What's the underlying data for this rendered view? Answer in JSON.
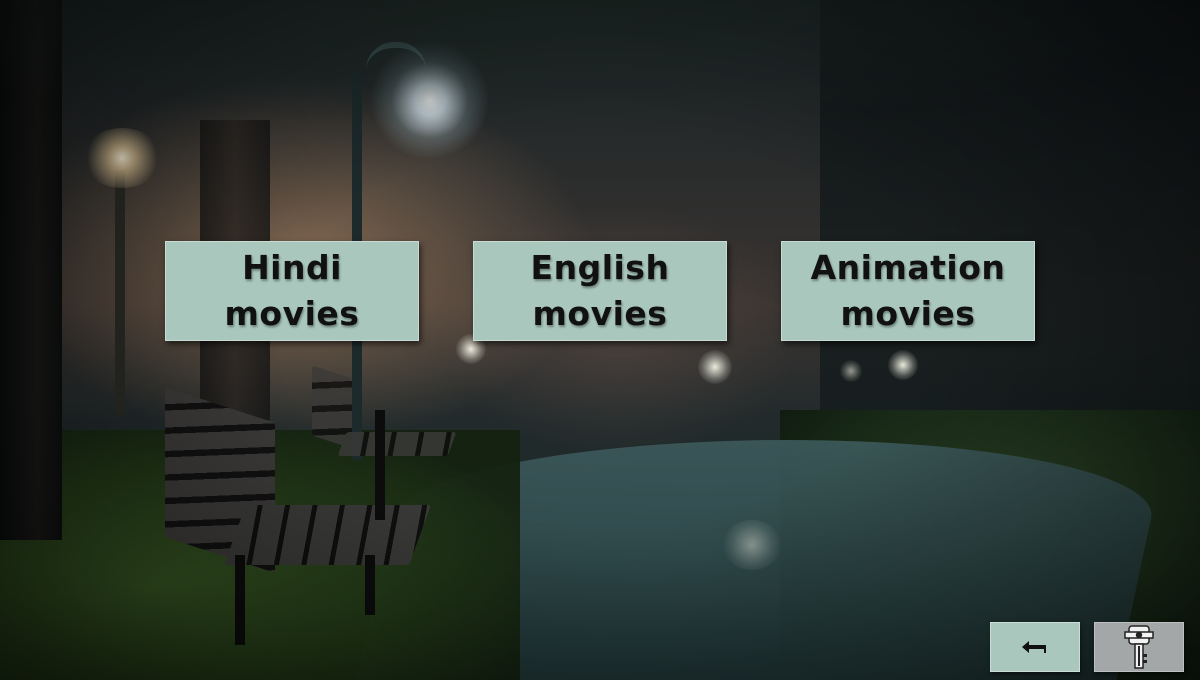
{
  "menu": {
    "hindi": {
      "line1": "Hindi",
      "line2": "movies"
    },
    "english": {
      "line1": "English",
      "line2": "movies"
    },
    "animation": {
      "line1": "Animation",
      "line2": "movies"
    }
  },
  "controls": {
    "back_icon": "back-arrow-icon",
    "key_icon": "key-icon"
  },
  "colors": {
    "button_bg": "#a9c7bd",
    "key_button_bg": "#a3a7a8",
    "label_text": "#111111"
  }
}
